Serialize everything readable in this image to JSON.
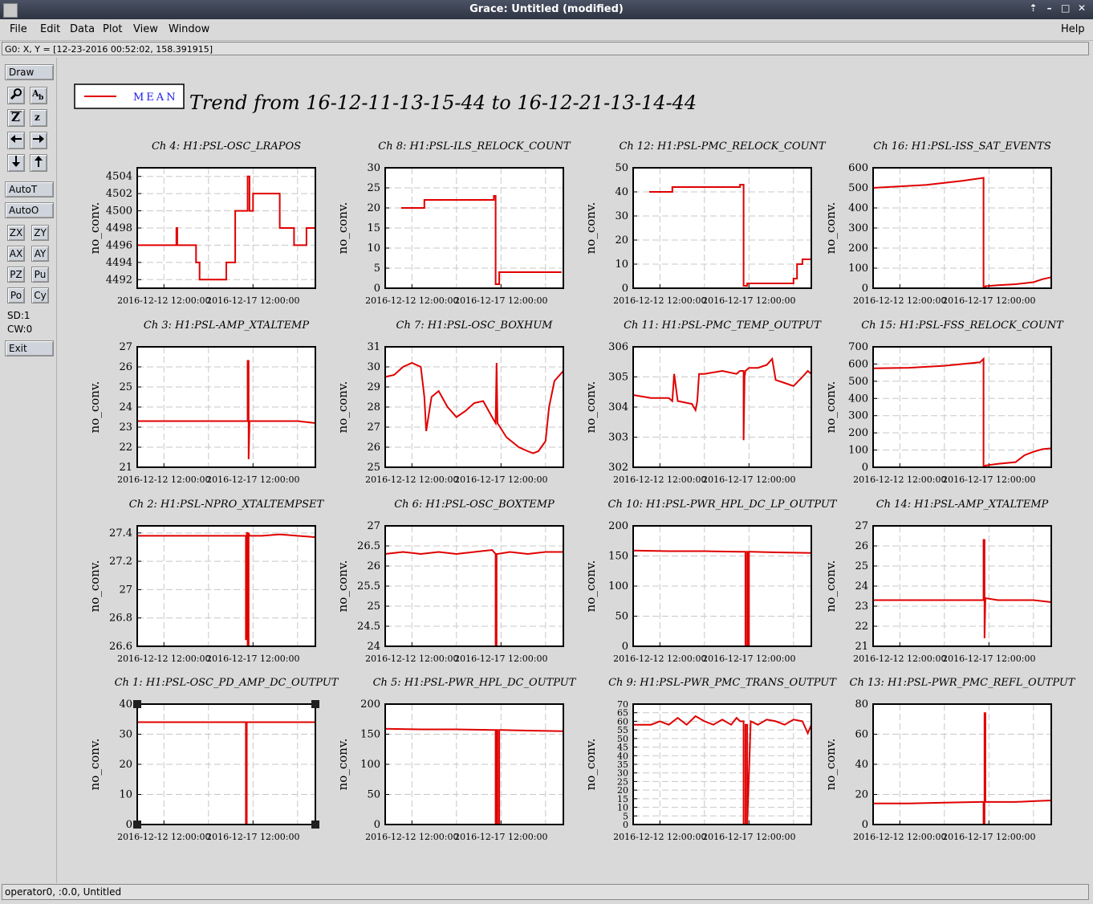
{
  "window": {
    "title": "Grace: Untitled (modified)"
  },
  "menu": {
    "items": [
      "File",
      "Edit",
      "Data",
      "Plot",
      "View",
      "Window"
    ],
    "help": "Help"
  },
  "locator": "G0: X, Y = [12-23-2016 00:52:02, 158.391915]",
  "toolbar": {
    "draw": "Draw",
    "autot": "AutoT",
    "autoo": "AutoO",
    "zx": "ZX",
    "zy": "ZY",
    "ax": "AX",
    "ay": "AY",
    "pz": "PZ",
    "pu": "Pu",
    "po": "Po",
    "cy": "Cy",
    "sd": "SD:1",
    "cw": "CW:0",
    "exit": "Exit",
    "icons": [
      "magnifier-icon",
      "text-icon",
      "zoom-out-icon",
      "zoom-in-icon",
      "arrow-left-icon",
      "arrow-right-icon",
      "arrow-down-icon",
      "arrow-up-icon"
    ]
  },
  "status": "operator0, :0.0, Untitled",
  "plot_title": "Trend from 16-12-11-13-15-44 to 16-12-21-13-14-44",
  "legend": {
    "label": "MEAN",
    "color": "#e00000"
  },
  "colors": {
    "line": "#e00000",
    "grid": "#c8c8c8",
    "label": "#000000",
    "legend_text": "#1a1ae6"
  },
  "chart_data": [
    {
      "type": "line",
      "title": "Ch 4: H1:PSL-OSC_LRAPOS",
      "ylabel": "no_conv.",
      "x_ticks": [
        "2016-12-12 12:00:00",
        "2016-12-17 12:00:00"
      ],
      "yticks": [
        "4492",
        "4494",
        "4496",
        "4498",
        "4500",
        "4502",
        "4504"
      ],
      "ylim": [
        4491,
        4505
      ],
      "series": [
        {
          "x": [
            0,
            0.22,
            0.22,
            0.225,
            0.225,
            0.33,
            0.33,
            0.35,
            0.35,
            0.5,
            0.5,
            0.55,
            0.55,
            0.62,
            0.62,
            0.63,
            0.63,
            0.65,
            0.65,
            0.8,
            0.8,
            0.88,
            0.88,
            0.95,
            0.95,
            0.97,
            0.97,
            1.0
          ],
          "y": [
            4496,
            4496,
            4498,
            4498,
            4496,
            4496,
            4494,
            4494,
            4492,
            4492,
            4494,
            4494,
            4500,
            4500,
            4504,
            4504,
            4500,
            4500,
            4502,
            4502,
            4498,
            4498,
            4496,
            4496,
            4498,
            4498,
            4498,
            4498
          ]
        }
      ]
    },
    {
      "type": "line",
      "title": "Ch 8: H1:PSL-ILS_RELOCK_COUNT",
      "ylabel": "no_conv.",
      "x_ticks": [
        "2016-12-12 12:00:00",
        "2016-12-17 12:00:00"
      ],
      "yticks": [
        "0",
        "5",
        "10",
        "15",
        "20",
        "25",
        "30"
      ],
      "ylim": [
        0,
        30
      ],
      "series": [
        {
          "x": [
            0.09,
            0.22,
            0.22,
            0.61,
            0.61,
            0.62,
            0.62,
            0.64,
            0.64,
            0.99
          ],
          "y": [
            20,
            20,
            22,
            22,
            23,
            23,
            1,
            1,
            4,
            4
          ]
        }
      ]
    },
    {
      "type": "line",
      "title": "Ch 12: H1:PSL-PMC_RELOCK_COUNT",
      "ylabel": "no_conv.",
      "x_ticks": [
        "2016-12-12 12:00:00",
        "2016-12-17 12:00:00"
      ],
      "yticks": [
        "0",
        "10",
        "20",
        "30",
        "40",
        "50"
      ],
      "ylim": [
        0,
        50
      ],
      "series": [
        {
          "x": [
            0.09,
            0.22,
            0.22,
            0.6,
            0.6,
            0.62,
            0.62,
            0.64,
            0.64,
            0.9,
            0.9,
            0.92,
            0.92,
            0.95,
            0.95,
            1.0
          ],
          "y": [
            40,
            40,
            42,
            42,
            43,
            43,
            1,
            1,
            2,
            2,
            4,
            4,
            10,
            10,
            12,
            12
          ]
        }
      ]
    },
    {
      "type": "line",
      "title": "Ch 16: H1:PSL-ISS_SAT_EVENTS",
      "ylabel": "no_conv.",
      "x_ticks": [
        "2016-12-12 12:00:00",
        "2016-12-17 12:00:00"
      ],
      "yticks": [
        "0",
        "100",
        "200",
        "300",
        "400",
        "500",
        "600"
      ],
      "ylim": [
        0,
        600
      ],
      "series": [
        {
          "x": [
            0,
            0.1,
            0.3,
            0.5,
            0.62,
            0.62,
            0.63,
            0.63,
            0.7,
            0.8,
            0.9,
            0.95,
            1.0
          ],
          "y": [
            500,
            505,
            515,
            535,
            550,
            5,
            5,
            10,
            15,
            20,
            30,
            45,
            55
          ]
        }
      ]
    },
    {
      "type": "line",
      "title": "Ch 3: H1:PSL-AMP_XTALTEMP",
      "ylabel": "no_conv.",
      "x_ticks": [
        "2016-12-12 12:00:00",
        "2016-12-17 12:00:00"
      ],
      "yticks": [
        "21",
        "22",
        "23",
        "24",
        "25",
        "26",
        "27"
      ],
      "ylim": [
        21,
        27
      ],
      "series": [
        {
          "x": [
            0,
            0.2,
            0.4,
            0.6,
            0.62,
            0.62,
            0.625,
            0.625,
            0.63,
            0.7,
            0.8,
            0.9,
            1.0
          ],
          "y": [
            23.3,
            23.3,
            23.3,
            23.3,
            23.3,
            26.3,
            26.3,
            21.4,
            23.3,
            23.3,
            23.3,
            23.3,
            23.2
          ]
        }
      ]
    },
    {
      "type": "line",
      "title": "Ch 7: H1:PSL-OSC_BOXHUM",
      "ylabel": "no_conv.",
      "x_ticks": [
        "2016-12-12 12:00:00",
        "2016-12-17 12:00:00"
      ],
      "yticks": [
        "25",
        "26",
        "27",
        "28",
        "29",
        "30",
        "31"
      ],
      "ylim": [
        25,
        31
      ],
      "series": [
        {
          "x": [
            0,
            0.05,
            0.1,
            0.15,
            0.2,
            0.22,
            0.23,
            0.26,
            0.3,
            0.35,
            0.4,
            0.45,
            0.5,
            0.55,
            0.6,
            0.62,
            0.625,
            0.63,
            0.68,
            0.75,
            0.8,
            0.83,
            0.86,
            0.9,
            0.92,
            0.95,
            1.0
          ],
          "y": [
            29.5,
            29.6,
            30,
            30.2,
            30,
            28.5,
            26.8,
            28.5,
            28.8,
            28,
            27.5,
            27.8,
            28.2,
            28.3,
            27.5,
            27.2,
            30.2,
            27.2,
            26.5,
            26,
            25.8,
            25.7,
            25.8,
            26.3,
            28,
            29.3,
            29.8
          ]
        }
      ]
    },
    {
      "type": "line",
      "title": "Ch 11: H1:PSL-PMC_TEMP_OUTPUT",
      "ylabel": "no_conv.",
      "x_ticks": [
        "2016-12-12 12:00:00",
        "2016-12-17 12:00:00"
      ],
      "yticks": [
        "302",
        "303",
        "304",
        "305",
        "306"
      ],
      "ylim": [
        302,
        306
      ],
      "series": [
        {
          "x": [
            0,
            0.1,
            0.2,
            0.22,
            0.23,
            0.25,
            0.33,
            0.35,
            0.36,
            0.37,
            0.38,
            0.4,
            0.5,
            0.58,
            0.6,
            0.62,
            0.62,
            0.625,
            0.63,
            0.65,
            0.7,
            0.75,
            0.78,
            0.8,
            0.85,
            0.9,
            0.95,
            0.98,
            1.0
          ],
          "y": [
            304.4,
            304.3,
            304.3,
            304.2,
            305.1,
            304.2,
            304.1,
            303.9,
            304.2,
            305.1,
            305.1,
            305.1,
            305.2,
            305.1,
            305.2,
            305.2,
            302.9,
            305,
            305.2,
            305.3,
            305.3,
            305.4,
            305.6,
            304.9,
            304.8,
            304.7,
            305,
            305.2,
            305.1
          ]
        }
      ]
    },
    {
      "type": "line",
      "title": "Ch 15: H1:PSL-FSS_RELOCK_COUNT",
      "ylabel": "no_conv.",
      "x_ticks": [
        "2016-12-12 12:00:00",
        "2016-12-17 12:00:00"
      ],
      "yticks": [
        "0",
        "100",
        "200",
        "300",
        "400",
        "500",
        "600",
        "700"
      ],
      "ylim": [
        0,
        700
      ],
      "series": [
        {
          "x": [
            0,
            0.2,
            0.4,
            0.6,
            0.62,
            0.62,
            0.63,
            0.63,
            0.7,
            0.8,
            0.85,
            0.9,
            0.95,
            1.0
          ],
          "y": [
            575,
            578,
            590,
            610,
            630,
            5,
            5,
            10,
            20,
            30,
            70,
            90,
            105,
            110
          ]
        }
      ]
    },
    {
      "type": "line",
      "title": "Ch 2: H1:PSL-NPRO_XTALTEMPSET",
      "ylabel": "no_conv.",
      "x_ticks": [
        "2016-12-12 12:00:00",
        "2016-12-17 12:00:00"
      ],
      "yticks": [
        "26.6",
        "26.8",
        "27",
        "27.2",
        "27.4"
      ],
      "ylim": [
        26.6,
        27.45
      ],
      "series": [
        {
          "x": [
            0,
            0.2,
            0.4,
            0.6,
            0.61,
            0.61,
            0.615,
            0.615,
            0.62,
            0.62,
            0.625,
            0.625,
            0.63,
            0.7,
            0.8,
            0.9,
            1.0
          ],
          "y": [
            27.38,
            27.38,
            27.38,
            27.38,
            27.38,
            26.65,
            26.65,
            27.4,
            27.4,
            26.6,
            26.6,
            27.4,
            27.38,
            27.38,
            27.39,
            27.38,
            27.37
          ]
        }
      ]
    },
    {
      "type": "line",
      "title": "Ch 6: H1:PSL-OSC_BOXTEMP",
      "ylabel": "no_conv.",
      "x_ticks": [
        "2016-12-12 12:00:00",
        "2016-12-17 12:00:00"
      ],
      "yticks": [
        "24",
        "24.5",
        "25",
        "25.5",
        "26",
        "26.5",
        "27"
      ],
      "ylim": [
        24,
        27
      ],
      "series": [
        {
          "x": [
            0,
            0.1,
            0.2,
            0.3,
            0.4,
            0.5,
            0.6,
            0.62,
            0.62,
            0.625,
            0.625,
            0.63,
            0.7,
            0.8,
            0.9,
            1.0
          ],
          "y": [
            26.3,
            26.35,
            26.3,
            26.35,
            26.3,
            26.35,
            26.4,
            26.3,
            24,
            24,
            26.3,
            26.3,
            26.35,
            26.3,
            26.35,
            26.35
          ]
        }
      ]
    },
    {
      "type": "line",
      "title": "Ch 10: H1:PSL-PWR_HPL_DC_LP_OUTPUT",
      "ylabel": "no_conv.",
      "x_ticks": [
        "2016-12-12 12:00:00",
        "2016-12-17 12:00:00"
      ],
      "yticks": [
        "0",
        "50",
        "100",
        "150",
        "200"
      ],
      "ylim": [
        0,
        200
      ],
      "series": [
        {
          "x": [
            0,
            0.2,
            0.4,
            0.6,
            0.63,
            0.63,
            0.64,
            0.64,
            0.645,
            0.645,
            0.65,
            0.65,
            0.66,
            0.8,
            1.0
          ],
          "y": [
            159,
            158,
            158,
            157,
            157,
            0,
            0,
            157,
            157,
            0,
            0,
            157,
            157,
            156,
            155
          ]
        }
      ]
    },
    {
      "type": "line",
      "title": "Ch 14: H1:PSL-AMP_XTALTEMP",
      "ylabel": "no_conv.",
      "x_ticks": [
        "2016-12-12 12:00:00",
        "2016-12-17 12:00:00"
      ],
      "yticks": [
        "21",
        "22",
        "23",
        "24",
        "25",
        "26",
        "27"
      ],
      "ylim": [
        21,
        27
      ],
      "series": [
        {
          "x": [
            0,
            0.2,
            0.4,
            0.6,
            0.62,
            0.62,
            0.625,
            0.625,
            0.63,
            0.7,
            0.8,
            0.9,
            1.0
          ],
          "y": [
            23.3,
            23.3,
            23.3,
            23.3,
            23.3,
            26.3,
            26.3,
            21.4,
            23.4,
            23.3,
            23.3,
            23.3,
            23.2
          ]
        }
      ]
    },
    {
      "type": "line",
      "title": "Ch 1: H1:PSL-OSC_PD_AMP_DC_OUTPUT",
      "ylabel": "no_conv.",
      "x_ticks": [
        "2016-12-12 12:00:00",
        "2016-12-17 12:00:00"
      ],
      "yticks": [
        "0",
        "10",
        "20",
        "30",
        "40"
      ],
      "ylim": [
        0,
        40
      ],
      "series": [
        {
          "x": [
            0,
            0.6,
            0.61,
            0.61,
            0.615,
            0.615,
            0.62,
            1.0
          ],
          "y": [
            34,
            34,
            34,
            0,
            0,
            34,
            34,
            34
          ]
        }
      ]
    },
    {
      "type": "line",
      "title": "Ch 5: H1:PSL-PWR_HPL_DC_OUTPUT",
      "ylabel": "no_conv.",
      "x_ticks": [
        "2016-12-12 12:00:00",
        "2016-12-17 12:00:00"
      ],
      "yticks": [
        "0",
        "50",
        "100",
        "150",
        "200"
      ],
      "ylim": [
        0,
        200
      ],
      "series": [
        {
          "x": [
            0,
            0.2,
            0.4,
            0.6,
            0.62,
            0.62,
            0.625,
            0.625,
            0.63,
            0.63,
            0.64,
            0.64,
            0.65,
            0.8,
            1.0
          ],
          "y": [
            159,
            158,
            158,
            157,
            157,
            0,
            0,
            157,
            157,
            0,
            0,
            157,
            157,
            156,
            155
          ]
        }
      ]
    },
    {
      "type": "line",
      "title": "Ch 9: H1:PSL-PWR_PMC_TRANS_OUTPUT",
      "ylabel": "no_conv.",
      "x_ticks": [
        "2016-12-12 12:00:00",
        "2016-12-17 12:00:00"
      ],
      "yticks": [
        "0",
        "5",
        "10",
        "15",
        "20",
        "25",
        "30",
        "35",
        "40",
        "45",
        "50",
        "55",
        "60",
        "65",
        "70"
      ],
      "ylim": [
        0,
        70
      ],
      "series": [
        {
          "x": [
            0,
            0.1,
            0.15,
            0.2,
            0.25,
            0.3,
            0.35,
            0.4,
            0.45,
            0.5,
            0.55,
            0.58,
            0.6,
            0.62,
            0.62,
            0.63,
            0.63,
            0.64,
            0.64,
            0.66,
            0.7,
            0.75,
            0.8,
            0.85,
            0.9,
            0.95,
            0.98,
            1.0
          ],
          "y": [
            58,
            58,
            60,
            58,
            62,
            58,
            63,
            60,
            58,
            61,
            58,
            62,
            60,
            60,
            0,
            0,
            58,
            58,
            0,
            60,
            58,
            61,
            60,
            58,
            61,
            60,
            53,
            58
          ]
        }
      ]
    },
    {
      "type": "line",
      "title": "Ch 13: H1:PSL-PWR_PMC_REFL_OUTPUT",
      "ylabel": "no_conv.",
      "x_ticks": [
        "2016-12-12 12:00:00",
        "2016-12-17 12:00:00"
      ],
      "yticks": [
        "0",
        "20",
        "40",
        "60",
        "80"
      ],
      "ylim": [
        0,
        80
      ],
      "series": [
        {
          "x": [
            0,
            0.2,
            0.4,
            0.6,
            0.62,
            0.62,
            0.625,
            0.625,
            0.63,
            0.63,
            0.64,
            0.7,
            0.8,
            0.9,
            1.0
          ],
          "y": [
            14,
            14,
            14.5,
            15,
            15,
            0,
            0,
            74,
            74,
            15,
            15,
            15,
            15,
            15.5,
            16
          ]
        }
      ]
    }
  ]
}
